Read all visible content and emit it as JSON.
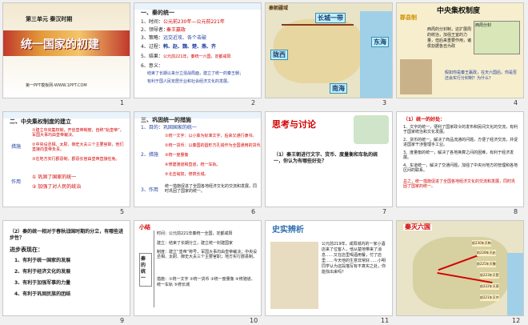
{
  "slides": [
    {
      "num": "1",
      "unit": "第三单元 秦汉时期",
      "title": "统一国家的初建",
      "footer": "第一PPT模板网-WWW.1PPT.COM"
    },
    {
      "num": "2",
      "heading": "一、秦的统一",
      "lines": [
        "1、时间：",
        "公元前230年—公元前221年",
        "2、领导者：",
        "秦王嬴政",
        "3、策略：",
        "远交近攻、各个击破",
        "4、过程：",
        "韩、赵、魏、楚、燕、齐",
        "5、结果：",
        "公元前221年，秦统一六国，定都咸阳",
        "6、意义：",
        "结束了长期以来分立混战局面，建立了统一的秦王朝；",
        "有利于国人民安居乐业和社会经济文化的发展。"
      ]
    },
    {
      "num": "3",
      "map_title": "秦朝疆域",
      "labels": [
        "长城一带",
        "东海",
        "陇西",
        "南海"
      ]
    },
    {
      "num": "4",
      "title": "中央集权制度",
      "side_title": "郡县制",
      "text": [
        "西周的分封制，这扩展周的统治，加强王室的力量，但后来重要作用，诸侯割据各自为政",
        "假如你是秦王嬴政，在天六国后，你是否还会实行分封制？为什么？"
      ],
      "badge": "西周分封"
    },
    {
      "num": "5",
      "heading": "二、中央集权制度的建立",
      "items": [
        "①建立中央集权制，开创皇帝制度，自称“始皇帝”，军国大事均由皇帝裁决。",
        "②中央设丞相、太尉、御史大夫三个主要官职，他们直接向皇帝负责。",
        "③在地方实行郡县制，郡县长官由皇帝直接任免。"
      ],
      "labels": [
        "措施",
        "作用"
      ],
      "effects": [
        "① 巩固了国家的统一",
        "② 加强了对人民的统治"
      ]
    },
    {
      "num": "6",
      "heading": "三、巩固统一的措施",
      "items": [
        "1、目的：巩固国家的统一",
        "①统一文字：以小篆为标准文字，后来又通行隶书。",
        "②统一货币：以秦国的圆形方孔钱作为全国通用的货币。",
        "③统一度量衡",
        "④修建驰道和直道，统一车轨。",
        "⑤北击匈奴，修筑长城。"
      ],
      "labels": [
        "2、措施",
        "3、作用"
      ],
      "effect": "统一措施促进了全国各地经济文化的交流和发展，同时巩固了国家的统一。"
    },
    {
      "num": "7",
      "title": "思考与讨论",
      "question": "（1）秦王朝进行文字、货币、度量衡和车轨的统一，你认为有哪些好处？"
    },
    {
      "num": "8",
      "heading": "（1）统一的好处：",
      "items": [
        "1、文字的统一，便利了国家政令的发布和民间文化的交流，有利于国家统治和文化发展。",
        "2、货币的统一，解决了商品流通的问题，方便了经济交流，并促进国家干涉整理手工业。",
        "3、度量衡的统一，解决了各地换算之间的困难，有利于经济发展。",
        "4、车道统一，解决了交通问题，加强了中央对地方的管理和各地区间的联系。"
      ],
      "summary": "总之，统一措施促进了全国各地经济文化的交流和发展，同时巩固了国家的统一。"
    },
    {
      "num": "9",
      "question": "（2）秦的统一相对于春秋战国时期的分立，有哪些进步性？",
      "sub": "进步表现在：",
      "items": [
        "1、有利于统一国家的发展",
        "2、有利于经济文化的发展",
        "3、有利于加强军事的力量",
        "4、有利于巩固民族的团结"
      ]
    },
    {
      "num": "10",
      "title": "小结",
      "center": "秦的统一",
      "lines": [
        "时间：公元前221年秦统一全国，定都咸阳",
        "建立：结束了长期分立，建立统一封建国家",
        "制度：建立“皇帝”称号，军国大事均由皇帝裁决；中央设丞相、太尉、御史大夫三个主要官职；地方实行郡县制。",
        "措施：①统一文字 ②统一货币 ③统一度量衡 ④修驰道、统一车轨 ⑤修长城"
      ]
    },
    {
      "num": "11",
      "title": "史实辨析",
      "text": "公元前219年，咸阳城内的一家小酒店来了位客人，他从楚地带来了消息……又在店里喝酒用餐，付了店里……今天他的生意非常好……小明同学认为这段描写有不真实之处，你能找出来吗？"
    },
    {
      "num": "12",
      "title": "秦灭六国",
      "badges": [
        "前230年灭韩",
        "前228年灭赵",
        "前225年灭魏",
        "前223年灭楚",
        "前222年灭燕",
        "前221年灭齐"
      ]
    }
  ],
  "colors": {
    "red": "#d40000",
    "blue": "#2040a0",
    "band": "#c0392b",
    "water": "#9fd0e8"
  }
}
